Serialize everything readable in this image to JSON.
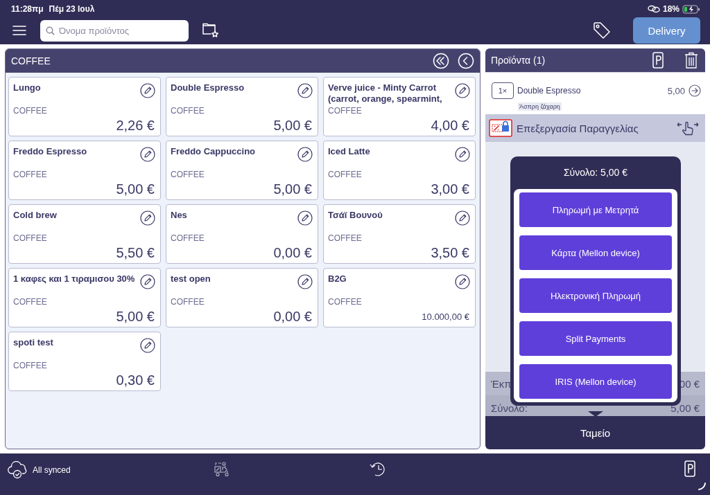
{
  "status_bar": {
    "time": "11:28πμ",
    "date": "Πέμ 23 Ιουλ",
    "battery": "18%"
  },
  "toolbar": {
    "search": {
      "placeholder": "Όνομα προϊόντος"
    },
    "delivery_button": "Delivery"
  },
  "category_panel": {
    "title": "COFFEE",
    "products": [
      {
        "name": "Lungo",
        "category": "COFFEE",
        "price": "2,26 €"
      },
      {
        "name": "Double Espresso",
        "category": "COFFEE",
        "price": "5,00 €"
      },
      {
        "name": "Verve juice - Minty Carrot (carrot, orange, spearmint,",
        "category": "COFFEE",
        "price": "4,00 €"
      },
      {
        "name": "Freddo Espresso",
        "category": "COFFEE",
        "price": "5,00 €"
      },
      {
        "name": "Freddo Cappuccino",
        "category": "COFFEE",
        "price": "5,00 €"
      },
      {
        "name": "Iced Latte",
        "category": "COFFEE",
        "price": "3,00 €"
      },
      {
        "name": "Cold brew",
        "category": "COFFEE",
        "price": "5,50 €"
      },
      {
        "name": "Nes",
        "category": "COFFEE",
        "price": "0,00 €"
      },
      {
        "name": "Τσάϊ Βουνού",
        "category": "COFFEE",
        "price": "3,50 €"
      },
      {
        "name": "1 καφες και 1 τιραμισου 30%",
        "category": "COFFEE",
        "price": "5,00 €"
      },
      {
        "name": "test open",
        "category": "COFFEE",
        "price": "0,00 €"
      },
      {
        "name": "B2G",
        "category": "COFFEE",
        "price": "10.000,00 €"
      },
      {
        "name": "spoti test",
        "category": "COFFEE",
        "price": "0,30 €"
      }
    ]
  },
  "order_panel": {
    "title": "Προϊόντα (1)",
    "items": [
      {
        "quantity": "1×",
        "name": "Double Espresso",
        "price": "5,00",
        "note": "Άσπρη ζάχαρη"
      }
    ],
    "process_order": "Επεξεργασία Παραγγελίας",
    "totals": [
      {
        "label": "Έκπ",
        "value": "00 €"
      },
      {
        "label": "Σύνολο:",
        "value": "5,00 €"
      }
    ],
    "checkout_button": "Ταμείο"
  },
  "payment_popup": {
    "title": "Σύνολο: 5,00 €",
    "options": [
      "Πληρωμή με Μετρητά",
      "Κάρτα (Mellon device)",
      "Ηλεκτρονική Πληρωμή",
      "Split Payments",
      "IRIS (Mellon device)"
    ]
  },
  "bottom_bar": {
    "sync_status": "All synced"
  }
}
